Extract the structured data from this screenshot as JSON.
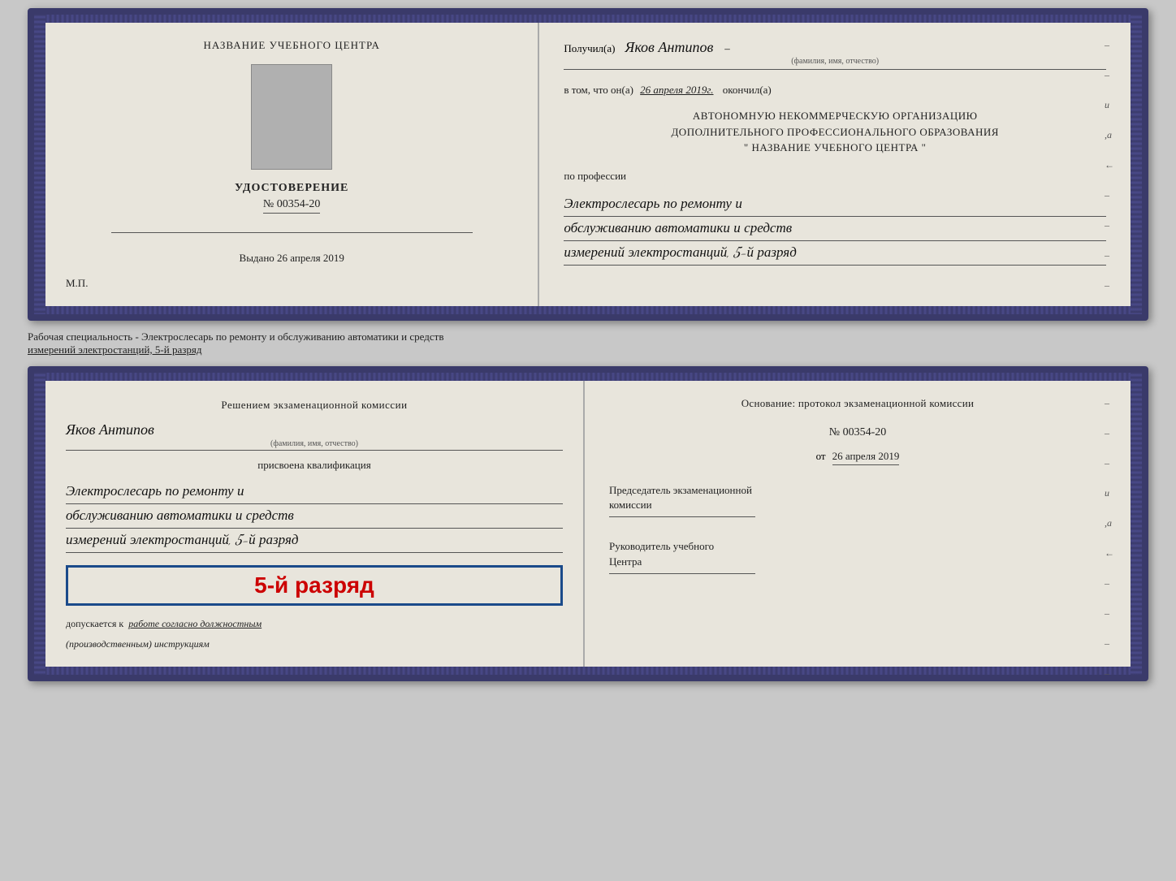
{
  "doc1": {
    "left": {
      "center_name": "НАЗВАНИЕ УЧЕБНОГО ЦЕНТРА",
      "udostoverenie_title": "УДОСТОВЕРЕНИЕ",
      "udostoverenie_num": "№ 00354-20",
      "vydano_label": "Выдано",
      "vydano_date": "26 апреля 2019",
      "mp": "М.П."
    },
    "right": {
      "poluchil_label": "Получил(а)",
      "poluchil_name": "Яков Антипов",
      "fio_sub": "(фамилия, имя, отчество)",
      "vtom_label": "в том, что он(а)",
      "vtom_date": "26 апреля 2019г.",
      "okonchil": "окончил(а)",
      "org_line1": "АВТОНОМНУЮ НЕКОММЕРЧЕСКУЮ ОРГАНИЗАЦИЮ",
      "org_line2": "ДОПОЛНИТЕЛЬНОГО ПРОФЕССИОНАЛЬНОГО ОБРАЗОВАНИЯ",
      "org_line3": "\"   НАЗВАНИЕ УЧЕБНОГО ЦЕНТРА   \"",
      "po_professii": "по профессии",
      "profession_line1": "Электрослесарь по ремонту и",
      "profession_line2": "обслуживанию автоматики и средств",
      "profession_line3": "измерений электростанций, 5-й разряд"
    }
  },
  "between": {
    "text": "Рабочая специальность - Электрослесарь по ремонту и обслуживанию автоматики и средств",
    "text2": "измерений электростанций, 5-й разряд"
  },
  "doc2": {
    "left": {
      "resheniem_line1": "Решением экзаменационной комиссии",
      "person_name": "Яков Антипов",
      "fio_sub": "(фамилия, имя, отчество)",
      "prisvoena": "присвоена квалификация",
      "qual_line1": "Электрослесарь по ремонту и",
      "qual_line2": "обслуживанию автоматики и средств",
      "qual_line3": "измерений электростанций, 5-й разряд",
      "razryad_badge": "5-й разряд",
      "dopuskaetsya": "допускается к",
      "dopuskaetsya_cont": "работе согласно должностным",
      "instruktsii": "(производственным) инструкциям"
    },
    "right": {
      "osnovanie_label": "Основание: протокол экзаменационной комиссии",
      "protocol_num": "№ 00354-20",
      "ot_label": "от",
      "ot_date": "26 апреля 2019",
      "predsedatel_label": "Председатель экзаменационной",
      "komissii_label": "комиссии",
      "rukovoditel_label": "Руководитель учебного",
      "tsentra_label": "Центра"
    }
  }
}
